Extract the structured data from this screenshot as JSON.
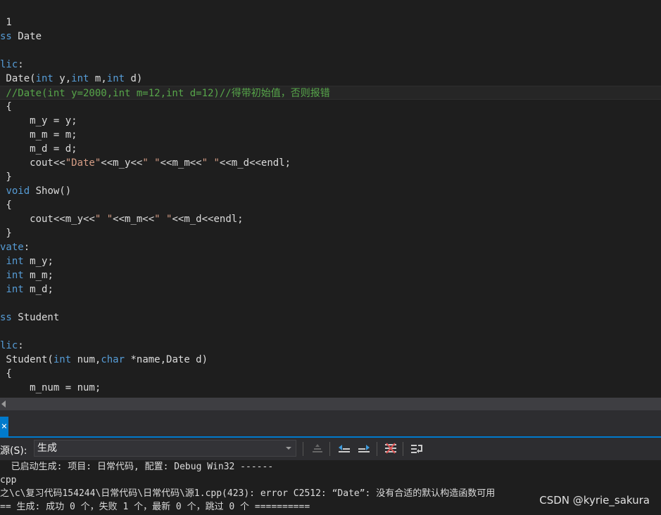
{
  "editor": {
    "lines": [
      [
        {
          "t": "tx",
          "v": " 1"
        }
      ],
      [
        {
          "t": "kw",
          "v": "ss"
        },
        {
          "t": "tx",
          "v": " Date"
        }
      ],
      [
        {
          "t": "tx",
          "v": ""
        }
      ],
      [
        {
          "t": "kw",
          "v": "lic"
        },
        {
          "t": "tx",
          "v": ":"
        }
      ],
      [
        {
          "t": "tx",
          "v": " Date("
        },
        {
          "t": "kw",
          "v": "int"
        },
        {
          "t": "tx",
          "v": " y,"
        },
        {
          "t": "kw",
          "v": "int"
        },
        {
          "t": "tx",
          "v": " m,"
        },
        {
          "t": "kw",
          "v": "int"
        },
        {
          "t": "tx",
          "v": " d)"
        }
      ],
      [
        {
          "t": "cm",
          "v": " //Date(int y=2000,int m=12,int d=12)//得带初始值，否则报错"
        }
      ],
      [
        {
          "t": "tx",
          "v": " {"
        }
      ],
      [
        {
          "t": "tx",
          "v": "     m_y = y;"
        }
      ],
      [
        {
          "t": "tx",
          "v": "     m_m = m;"
        }
      ],
      [
        {
          "t": "tx",
          "v": "     m_d = d;"
        }
      ],
      [
        {
          "t": "tx",
          "v": "     cout<<"
        },
        {
          "t": "st",
          "v": "\"Date\""
        },
        {
          "t": "tx",
          "v": "<<m_y<<"
        },
        {
          "t": "st",
          "v": "\" \""
        },
        {
          "t": "tx",
          "v": "<<m_m<<"
        },
        {
          "t": "st",
          "v": "\" \""
        },
        {
          "t": "tx",
          "v": "<<m_d<<endl;"
        }
      ],
      [
        {
          "t": "tx",
          "v": " }"
        }
      ],
      [
        {
          "t": "tx",
          "v": " "
        },
        {
          "t": "kw",
          "v": "void"
        },
        {
          "t": "tx",
          "v": " Show()"
        }
      ],
      [
        {
          "t": "tx",
          "v": " {"
        }
      ],
      [
        {
          "t": "tx",
          "v": "     cout<<m_y<<"
        },
        {
          "t": "st",
          "v": "\" \""
        },
        {
          "t": "tx",
          "v": "<<m_m<<"
        },
        {
          "t": "st",
          "v": "\" \""
        },
        {
          "t": "tx",
          "v": "<<m_d<<endl;"
        }
      ],
      [
        {
          "t": "tx",
          "v": " }"
        }
      ],
      [
        {
          "t": "kw",
          "v": "vate"
        },
        {
          "t": "tx",
          "v": ":"
        }
      ],
      [
        {
          "t": "tx",
          "v": " "
        },
        {
          "t": "kw",
          "v": "int"
        },
        {
          "t": "tx",
          "v": " m_y;"
        }
      ],
      [
        {
          "t": "tx",
          "v": " "
        },
        {
          "t": "kw",
          "v": "int"
        },
        {
          "t": "tx",
          "v": " m_m;"
        }
      ],
      [
        {
          "t": "tx",
          "v": " "
        },
        {
          "t": "kw",
          "v": "int"
        },
        {
          "t": "tx",
          "v": " m_d;"
        }
      ],
      [
        {
          "t": "tx",
          "v": ""
        }
      ],
      [
        {
          "t": "kw",
          "v": "ss"
        },
        {
          "t": "tx",
          "v": " Student"
        }
      ],
      [
        {
          "t": "tx",
          "v": ""
        }
      ],
      [
        {
          "t": "kw",
          "v": "lic"
        },
        {
          "t": "tx",
          "v": ":"
        }
      ],
      [
        {
          "t": "tx",
          "v": " Student("
        },
        {
          "t": "kw",
          "v": "int"
        },
        {
          "t": "tx",
          "v": " num,"
        },
        {
          "t": "kw",
          "v": "char"
        },
        {
          "t": "tx",
          "v": " *name,Date d)"
        }
      ],
      [
        {
          "t": "tx",
          "v": " {"
        }
      ],
      [
        {
          "t": "tx",
          "v": "     m_num = num;"
        }
      ]
    ],
    "current_line_index": 5
  },
  "output_panel": {
    "tab_close_glyph": "×",
    "source_label": "来源(S):",
    "source_value": "生成",
    "lines": [
      "  已启动生成: 项目: 日常代码, 配置: Debug Win32 ------",
      "cpp",
      "之\\c\\复习代码154244\\日常代码\\日常代码\\源1.cpp(423): error C2512: “Date”: 没有合适的默认构造函数可用",
      "== 生成: 成功 0 个，失败 1 个，最新 0 个，跳过 0 个 =========="
    ]
  },
  "toolbar_icons": [
    "go-to-previous-message-icon",
    "previous-icon",
    "next-icon",
    "clear-all-icon",
    "toggle-word-wrap-icon"
  ],
  "watermark": "CSDN @kyrie_sakura"
}
